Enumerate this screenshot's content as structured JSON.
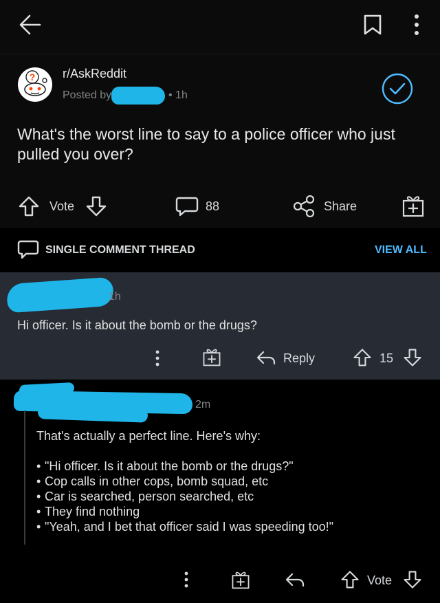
{
  "header": {
    "back_icon": "arrow-left-icon",
    "save_icon": "bookmark-icon",
    "more_icon": "kebab-icon"
  },
  "post": {
    "subreddit": "r/AskReddit",
    "posted_by_prefix": "Posted by",
    "age": "• 1h",
    "title": "What's the worst line to say to a police officer who just pulled you over?",
    "vote_label": "Vote",
    "comment_count": "88",
    "share_label": "Share"
  },
  "thread_bar": {
    "label": "SINGLE COMMENT THREAD",
    "view_all": "VIEW ALL"
  },
  "comment1": {
    "age": "1h",
    "text": "Hi officer. Is it about the bomb or the drugs?",
    "reply_label": "Reply",
    "score": "15"
  },
  "comment2": {
    "age": "2m",
    "intro": "That's actually a perfect line.  Here's why:",
    "bullets": [
      "\"Hi officer. Is it about the bomb or the drugs?\"",
      "Cop calls in other cops, bomb squad, etc",
      "Car is searched, person searched, etc",
      "They find nothing",
      "\"Yeah, and I bet that officer said I was speeding too!\""
    ],
    "vote_label": "Vote"
  },
  "colors": {
    "accent_blue": "#4fbcff",
    "redaction": "#1fb5e8",
    "comment_highlight_bg": "#272b33"
  }
}
